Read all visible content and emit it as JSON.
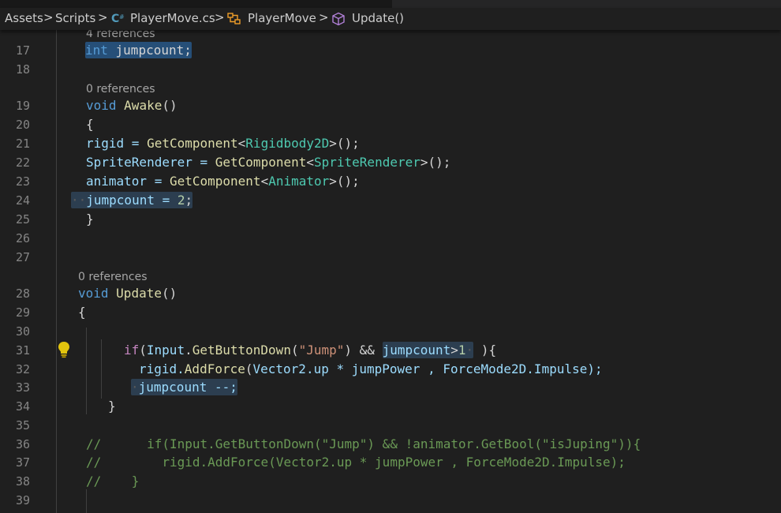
{
  "breadcrumb": {
    "items": [
      "Assets",
      "Scripts",
      "PlayerMove.cs",
      "PlayerMove",
      "Update()"
    ],
    "separator": ">"
  },
  "lines": [
    {
      "num": "17"
    },
    {
      "num": "18"
    },
    {
      "num": "19"
    },
    {
      "num": "20"
    },
    {
      "num": "21"
    },
    {
      "num": "22"
    },
    {
      "num": "23"
    },
    {
      "num": "24"
    },
    {
      "num": "25"
    },
    {
      "num": "26"
    },
    {
      "num": "27"
    },
    {
      "num": "28"
    },
    {
      "num": "29"
    },
    {
      "num": "30"
    },
    {
      "num": "31"
    },
    {
      "num": "32"
    },
    {
      "num": "33"
    },
    {
      "num": "34"
    },
    {
      "num": "35"
    },
    {
      "num": "36"
    },
    {
      "num": "37"
    },
    {
      "num": "38"
    },
    {
      "num": "39"
    }
  ],
  "lens": {
    "refs4": "4 references",
    "refs0a": "0 references",
    "refs0b": "0 references"
  },
  "code": {
    "l17": {
      "kw": "int",
      "rest": " jumpcount;"
    },
    "l19": {
      "kw": "void",
      "fn": "Awake",
      "rest": "()"
    },
    "l20": "{",
    "l21": {
      "a": "rigid = ",
      "fn": "GetComponent",
      "lt": "<",
      "ty": "Rigidbody2D",
      "gt": ">();"
    },
    "l22": {
      "a": "SpriteRenderer = ",
      "fn": "GetComponent",
      "lt": "<",
      "ty": "SpriteRenderer",
      "gt": ">();"
    },
    "l23": {
      "a": "animator = ",
      "fn": "GetComponent",
      "lt": "<",
      "ty": "Animator",
      "gt": ">();"
    },
    "l24": {
      "a": "jumpcount = ",
      "nm": "2",
      "b": ";"
    },
    "l25": "}",
    "l28": {
      "kw": "void",
      "fn": "Update",
      "rest": "()"
    },
    "l29": "{",
    "l31": {
      "kw": "if",
      "a": "(",
      "ty": "Input",
      "dot": ".",
      "fn": "GetButtonDown",
      "p1": "(",
      "st": "\"Jump\"",
      "p2": ") && ",
      "hv": "jumpcount",
      "op": ">",
      "nm": "1",
      "end": " ){"
    },
    "l32": {
      "a": "rigid.",
      "fn": "AddForce",
      "p1": "(",
      "ty": "Vector2",
      "b": ".up * jumpPower , ",
      "ty2": "ForceMode2D",
      "c": ".Impulse);"
    },
    "l33": {
      "a": "jumpcount --;"
    },
    "l34": "}",
    "l36": "//      if(Input.GetButtonDown(\"Jump\") && !animator.GetBool(\"isJuping\")){",
    "l37": "//        rigid.AddForce(Vector2.up * jumpPower , ForceMode2D.Impulse);",
    "l38": "//    }"
  },
  "colors": {
    "background": "#1f1f1f",
    "keyword": "#569cd6",
    "type": "#4ec9b0",
    "function": "#dcdcaa",
    "string": "#ce9178",
    "number": "#b5cea8",
    "comment": "#6a9955",
    "highlight": "#264f78"
  },
  "icons": {
    "csharp": "csharp-file-icon",
    "class": "class-icon",
    "method": "method-cube-icon",
    "bulb": "lightbulb-icon"
  }
}
